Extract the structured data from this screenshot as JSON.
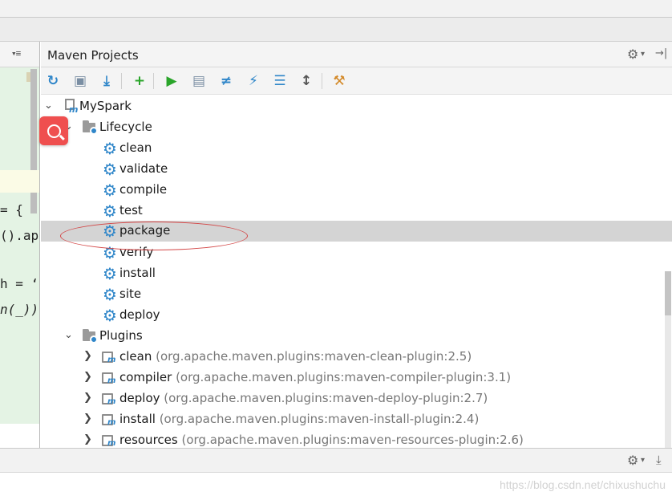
{
  "panel": {
    "title": "Maven Projects",
    "settings_icon": "⚙",
    "settings_caret": "▾",
    "hide_icon": "→|"
  },
  "editor": {
    "header_icon": "▾≡",
    "lines": [
      "= {",
      "().app",
      "h = ‘",
      "n(_))"
    ]
  },
  "toolbar": {
    "buttons": [
      {
        "name": "reimport-icon",
        "glyph": "↻",
        "color": "#2f86c9"
      },
      {
        "name": "generate-sources-icon",
        "glyph": "▣",
        "color": "#7a8ea3"
      },
      {
        "name": "download-icon",
        "glyph": "⤓",
        "color": "#2f86c9"
      },
      {
        "name": "add-icon",
        "glyph": "+",
        "color": "#2aa52a"
      },
      {
        "name": "run-icon",
        "glyph": "▶",
        "color": "#2aa52a"
      },
      {
        "name": "run-config-icon",
        "glyph": "▤",
        "color": "#7a8ea3"
      },
      {
        "name": "toggle-offline-icon",
        "glyph": "≠",
        "color": "#2f86c9"
      },
      {
        "name": "skip-tests-icon",
        "glyph": "⚡",
        "color": "#2f86c9"
      },
      {
        "name": "show-dependencies-icon",
        "glyph": "☰",
        "color": "#2f86c9"
      },
      {
        "name": "collapse-all-icon",
        "glyph": "↕",
        "color": "#555555"
      },
      {
        "name": "maven-settings-icon",
        "glyph": "⚒",
        "color": "#d48a2a"
      }
    ]
  },
  "tree": {
    "project": "MySpark",
    "lifecycle_label": "Lifecycle",
    "lifecycle": [
      "clean",
      "validate",
      "compile",
      "test",
      "package",
      "verify",
      "install",
      "site",
      "deploy"
    ],
    "selected": "package",
    "plugins_label": "Plugins",
    "plugins": [
      {
        "name": "clean",
        "artifact": "(org.apache.maven.plugins:maven-clean-plugin:2.5)"
      },
      {
        "name": "compiler",
        "artifact": "(org.apache.maven.plugins:maven-compiler-plugin:3.1)"
      },
      {
        "name": "deploy",
        "artifact": "(org.apache.maven.plugins:maven-deploy-plugin:2.7)"
      },
      {
        "name": "install",
        "artifact": "(org.apache.maven.plugins:maven-install-plugin:2.4)"
      },
      {
        "name": "resources",
        "artifact": "(org.apache.maven.plugins:maven-resources-plugin:2.6)"
      }
    ]
  },
  "bottom": {
    "settings_icon": "⚙",
    "settings_caret": "▾",
    "pin_icon": "⤓"
  },
  "watermark": "https://blog.csdn.net/chixushuchu",
  "colors": {
    "accent": "#2f86c9",
    "selection": "#d4d4d4",
    "annotation": "#d34545",
    "search_button": "#ef4f4f"
  }
}
